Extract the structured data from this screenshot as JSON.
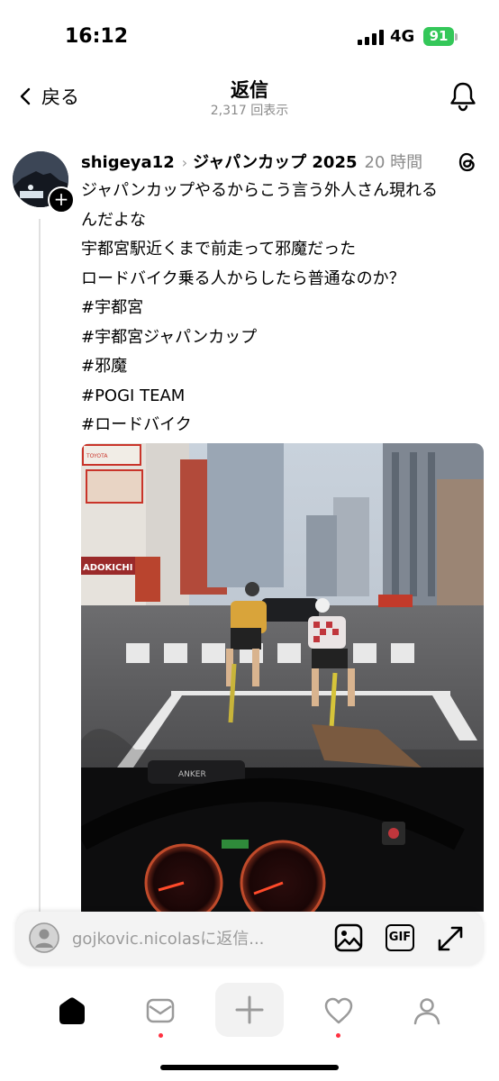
{
  "status_bar": {
    "time": "16:12",
    "network": "4G",
    "battery": "91"
  },
  "nav": {
    "back_label": "戻る",
    "title": "返信",
    "views": "2,317 回表示"
  },
  "post": {
    "username": "shigeya12",
    "topic": "ジャパンカップ 2025",
    "time": "20 時間",
    "lines": [
      "ジャパンカップやるからこう言う外人さん現れる",
      "んだよな",
      "宇都宮駅近くまで前走って邪魔だった",
      "ロードバイク乗る人からしたら普通なのか？",
      "#宇都宮",
      "#宇都宮ジャパンカップ",
      "#邪魔",
      "#POGI TEAM",
      "#ロードバイク"
    ],
    "photo_signs": {
      "sign1": "ADOKICHI",
      "sign2": "TOYOTA",
      "dash_brand": "ANKER"
    }
  },
  "reply": {
    "placeholder": "gojkovic.nicolasに返信...",
    "gif_label": "GIF"
  },
  "icons": {
    "back": "chevron-left-icon",
    "bell": "bell-icon",
    "threads": "threads-logo-icon",
    "image": "image-icon",
    "expand": "expand-icon",
    "tabs": [
      "home-icon",
      "inbox-icon",
      "plus-icon",
      "heart-icon",
      "profile-icon"
    ]
  },
  "colors": {
    "accent_green": "#34c759",
    "notification_dot": "#ff3040",
    "muted_text": "#8a8a8a"
  }
}
